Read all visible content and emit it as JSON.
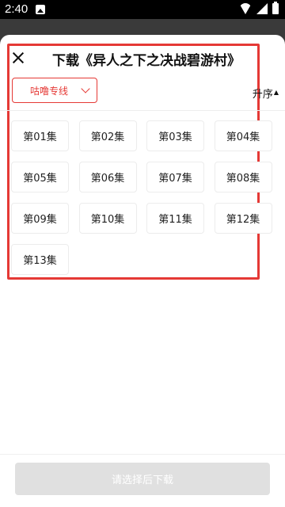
{
  "status_bar": {
    "time": "2:40",
    "icons": [
      "image-icon",
      "wifi-icon",
      "signal-icon",
      "battery-icon"
    ]
  },
  "sheet": {
    "title": "下载《异人之下之决战碧游村》",
    "source_select": {
      "label": "咕噜专线"
    },
    "sort": {
      "label": "升序",
      "arrow": "▲"
    },
    "episodes": [
      "第01集",
      "第02集",
      "第03集",
      "第04集",
      "第05集",
      "第06集",
      "第07集",
      "第08集",
      "第09集",
      "第10集",
      "第11集",
      "第12集",
      "第13集"
    ],
    "download_button": {
      "label": "请选择后下载",
      "enabled": false
    }
  },
  "colors": {
    "accent": "#e53935",
    "disabled_button": "#e0e0e0",
    "backdrop": "#3a3a3a"
  }
}
